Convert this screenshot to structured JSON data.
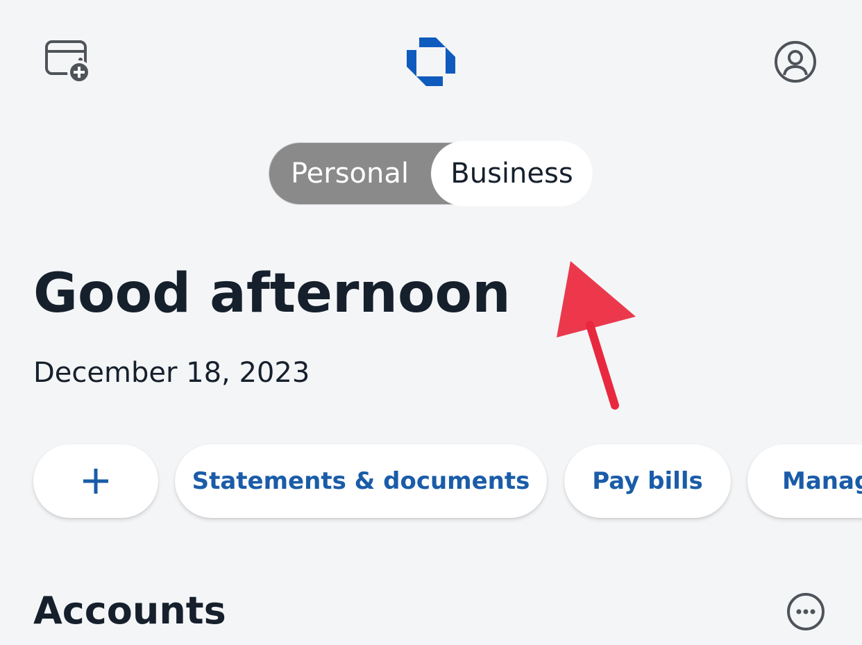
{
  "header": {
    "wallet_icon": "wallet-add-icon",
    "logo_icon": "bank-octagon-logo",
    "profile_icon": "profile-icon",
    "brand_color": "#0f5bbd"
  },
  "toggle": {
    "options": [
      "Personal",
      "Business"
    ],
    "selected": "Business"
  },
  "greeting": {
    "title": "Good afternoon",
    "date": "December 18, 2023"
  },
  "quick_actions": {
    "add_icon": "plus-icon",
    "items": [
      "Statements & documents",
      "Pay bills",
      "Manag"
    ]
  },
  "accounts": {
    "title": "Accounts",
    "more_icon": "more-options-icon"
  },
  "colors": {
    "accent": "#1a5ca8",
    "toggle_bg": "#8a8a8a",
    "text": "#16202c",
    "background": "#f4f5f7",
    "annotation": "#e8283e"
  }
}
